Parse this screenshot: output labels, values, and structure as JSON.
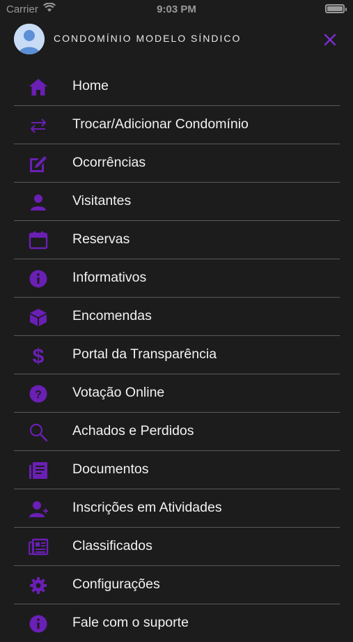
{
  "status_bar": {
    "carrier": "Carrier",
    "time": "9:03 PM"
  },
  "header": {
    "title": "CONDOMÍNIO MODELO SÍNDICO"
  },
  "colors": {
    "accent": "#6a1fb5",
    "background": "#1c1c1c",
    "divider": "#5a5a5a"
  },
  "menu": {
    "items": [
      {
        "label": "Home",
        "icon": "home-icon"
      },
      {
        "label": "Trocar/Adicionar Condomínio",
        "icon": "swap-icon"
      },
      {
        "label": "Ocorrências",
        "icon": "edit-icon"
      },
      {
        "label": "Visitantes",
        "icon": "person-icon"
      },
      {
        "label": "Reservas",
        "icon": "calendar-icon"
      },
      {
        "label": "Informativos",
        "icon": "info-icon"
      },
      {
        "label": "Encomendas",
        "icon": "package-icon"
      },
      {
        "label": "Portal da Transparência",
        "icon": "dollar-icon"
      },
      {
        "label": "Votação Online",
        "icon": "question-icon"
      },
      {
        "label": "Achados e Perdidos",
        "icon": "search-icon"
      },
      {
        "label": "Documentos",
        "icon": "document-icon"
      },
      {
        "label": "Inscrições em Atividades",
        "icon": "person-add-icon"
      },
      {
        "label": "Classificados",
        "icon": "newspaper-icon"
      },
      {
        "label": "Configurações",
        "icon": "gear-icon"
      },
      {
        "label": "Fale com o suporte",
        "icon": "support-icon"
      }
    ]
  }
}
